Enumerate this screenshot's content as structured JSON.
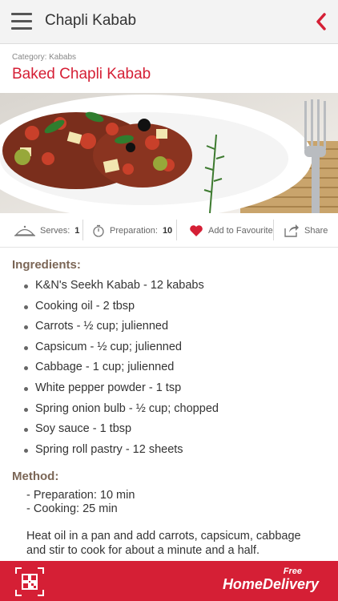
{
  "header": {
    "title": "Chapli Kabab"
  },
  "recipe": {
    "category": "Category: Kababs",
    "title": "Baked Chapli Kabab"
  },
  "stats": {
    "serves_label": "Serves:",
    "serves_value": "1",
    "prep_label": "Preparation:",
    "prep_value": "10",
    "favourite_label": "Add to Favourite",
    "share_label": "Share"
  },
  "ingredients": {
    "heading": "Ingredients:",
    "items": [
      "K&N's Seekh Kabab - 12 kababs",
      "Cooking oil - 2 tbsp",
      "Carrots - ½ cup; julienned",
      "Capsicum - ½ cup; julienned",
      "Cabbage - 1 cup; julienned",
      "White pepper powder - 1 tsp",
      "Spring onion bulb - ½ cup; chopped",
      "Soy sauce - 1 tbsp",
      "Spring roll pastry - 12 sheets"
    ]
  },
  "method": {
    "heading": "Method:",
    "preparation": "- Preparation: 10 min",
    "cooking": "- Cooking: 25 min",
    "text": "Heat oil in a pan and add carrots, capsicum, cabbage and stir to cook for about a minute and a half."
  },
  "footer": {
    "free": "Free",
    "delivery": "HomeDelivery"
  },
  "colors": {
    "accent": "#d51f35",
    "heading": "#7b6656",
    "topbar": "#f3f3f3"
  },
  "icons": [
    "menu-icon",
    "back-chevron-icon",
    "serves-icon",
    "timer-icon",
    "heart-icon",
    "share-icon",
    "qr-code-icon"
  ]
}
